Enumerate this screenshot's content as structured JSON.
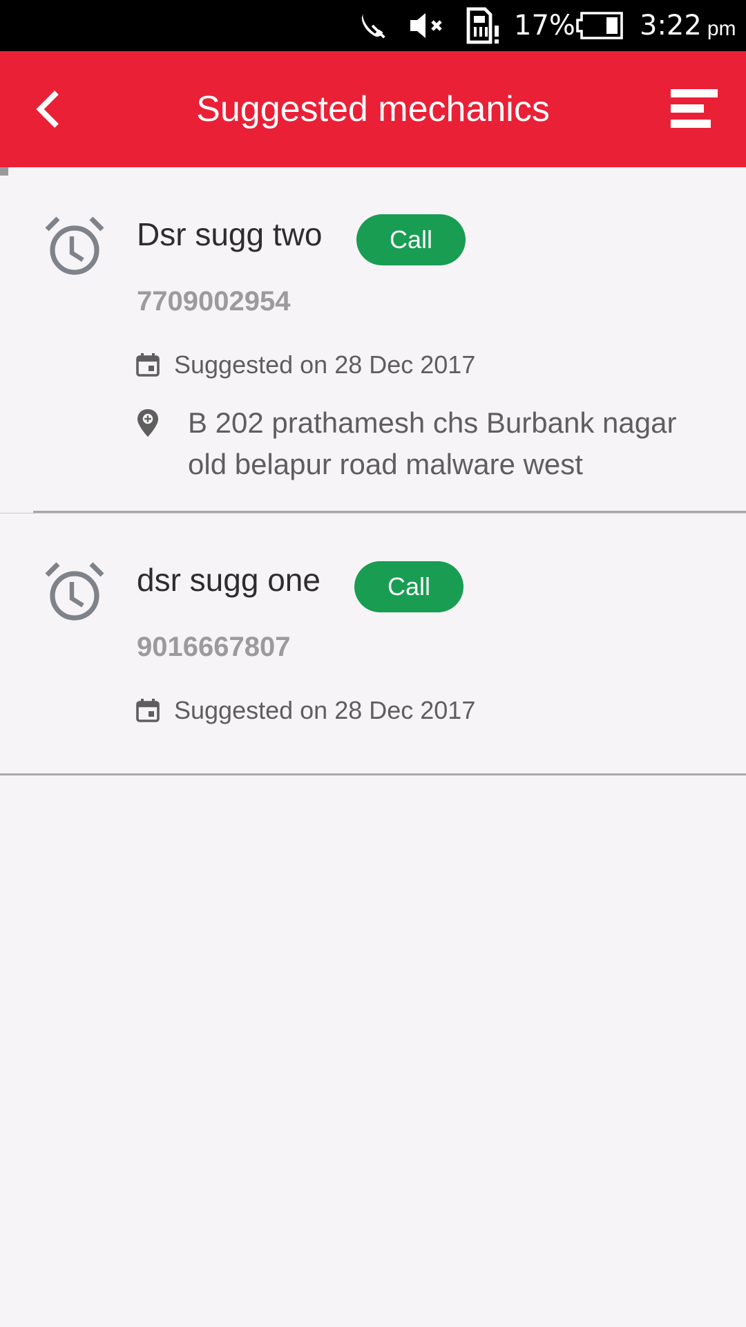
{
  "status_bar": {
    "battery_percent": "17%",
    "time": "3:22",
    "ampm": "pm",
    "icons": [
      "phone-mute-icon",
      "volume-mute-icon",
      "sim-alert-icon",
      "battery-icon"
    ]
  },
  "app_bar": {
    "title": "Suggested mechanics",
    "back_icon": "chevron-left-icon",
    "menu_icon": "menu-icon",
    "color": "#ea2036"
  },
  "mechanics": [
    {
      "name": "Dsr sugg two",
      "call_label": "Call",
      "phone": "7709002954",
      "suggested": "Suggested on 28 Dec 2017",
      "address_line1": "B 202 prathamesh chs Burbank nagar",
      "address_line2": "old belapur road malware west"
    },
    {
      "name": "dsr sugg one",
      "call_label": "Call",
      "phone": "9016667807",
      "suggested": "Suggested on 28 Dec 2017"
    }
  ],
  "colors": {
    "call_button": "#189d52",
    "background": "#f6f4f6"
  }
}
